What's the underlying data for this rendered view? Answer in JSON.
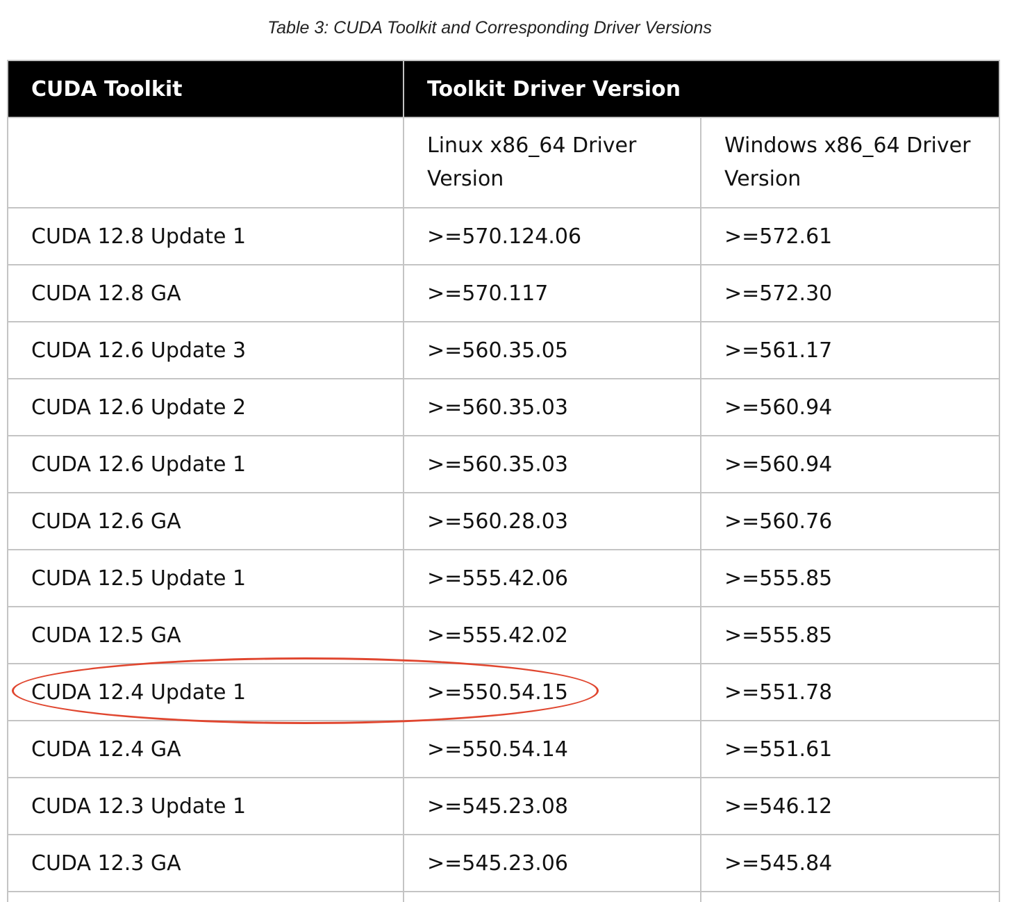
{
  "caption": "Table 3: CUDA Toolkit and Corresponding Driver Versions",
  "header": {
    "col1": "CUDA Toolkit",
    "col2": "Toolkit Driver Version"
  },
  "subheader": {
    "col1": "",
    "linux": "Linux x86_64 Driver Version",
    "windows": "Windows x86_64 Driver Version"
  },
  "rows": [
    {
      "toolkit": "CUDA 12.8 Update 1",
      "linux": ">=570.124.06",
      "windows": ">=572.61"
    },
    {
      "toolkit": "CUDA 12.8 GA",
      "linux": ">=570.117",
      "windows": ">=572.30"
    },
    {
      "toolkit": "CUDA 12.6 Update 3",
      "linux": ">=560.35.05",
      "windows": ">=561.17"
    },
    {
      "toolkit": "CUDA 12.6 Update 2",
      "linux": ">=560.35.03",
      "windows": ">=560.94"
    },
    {
      "toolkit": "CUDA 12.6 Update 1",
      "linux": ">=560.35.03",
      "windows": ">=560.94"
    },
    {
      "toolkit": "CUDA 12.6 GA",
      "linux": ">=560.28.03",
      "windows": ">=560.76"
    },
    {
      "toolkit": "CUDA 12.5 Update 1",
      "linux": ">=555.42.06",
      "windows": ">=555.85"
    },
    {
      "toolkit": "CUDA 12.5 GA",
      "linux": ">=555.42.02",
      "windows": ">=555.85"
    },
    {
      "toolkit": "CUDA 12.4 Update 1",
      "linux": ">=550.54.15",
      "windows": ">=551.78"
    },
    {
      "toolkit": "CUDA 12.4 GA",
      "linux": ">=550.54.14",
      "windows": ">=551.61"
    },
    {
      "toolkit": "CUDA 12.3 Update 1",
      "linux": ">=545.23.08",
      "windows": ">=546.12"
    },
    {
      "toolkit": "CUDA 12.3 GA",
      "linux": ">=545.23.06",
      "windows": ">=545.84"
    }
  ],
  "annotation": {
    "highlighted_row": "CUDA 12.4 Update 1",
    "color": "#e0462f"
  }
}
